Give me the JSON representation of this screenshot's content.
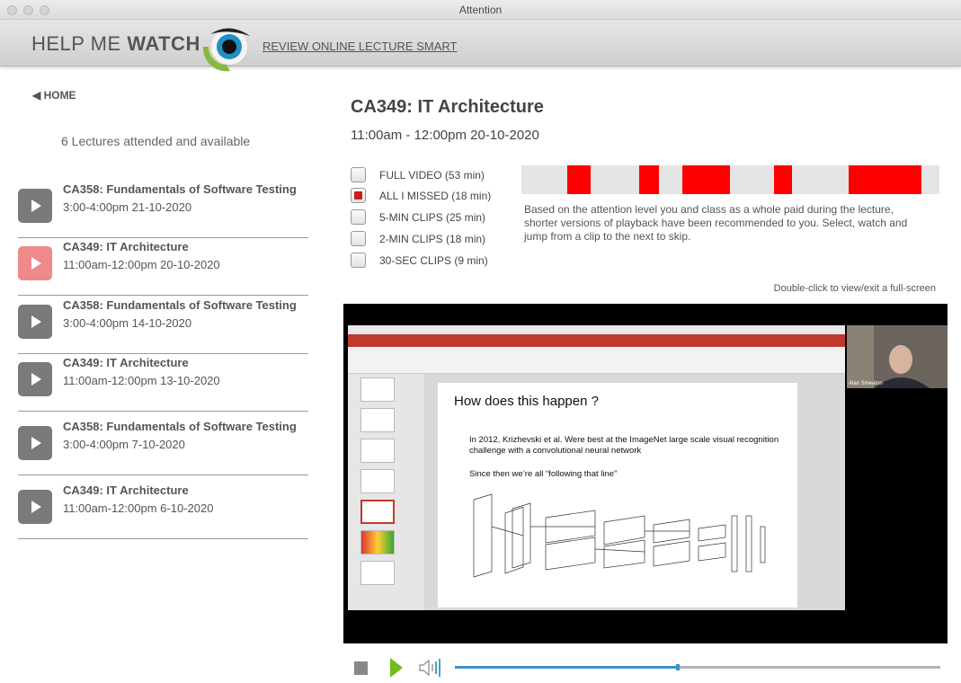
{
  "window": {
    "title": "Attention"
  },
  "header": {
    "brand_light": "HELP ME",
    "brand_bold": "WATCH",
    "tagline": "REVIEW ONLINE LECTURE SMART"
  },
  "sidebar": {
    "home_label": "◀ HOME",
    "summary": "6 Lectures attended and available",
    "lectures": [
      {
        "title": "CA358: Fundamentals of Software Testing",
        "time": "3:00-4:00pm 21-10-2020"
      },
      {
        "title": "CA349: IT Architecture",
        "time": "11:00am-12:00pm 20-10-2020"
      },
      {
        "title": "CA358: Fundamentals of Software Testing",
        "time": "3:00-4:00pm 14-10-2020"
      },
      {
        "title": "CA349: IT Architecture",
        "time": "11:00am-12:00pm 13-10-2020"
      },
      {
        "title": "CA358: Fundamentals of Software Testing",
        "time": "3:00-4:00pm 7-10-2020"
      },
      {
        "title": "CA349: IT Architecture",
        "time": "11:00am-12:00pm 6-10-2020"
      }
    ],
    "active_index": 1
  },
  "main": {
    "title": "CA349: IT Architecture",
    "time": "11:00am - 12:00pm 20-10-2020",
    "options": [
      {
        "label": "FULL VIDEO (53 min)",
        "checked": false
      },
      {
        "label": "ALL I MISSED (18 min)",
        "checked": true
      },
      {
        "label": "5-MIN CLIPS (25 min)",
        "checked": false
      },
      {
        "label": "2-MIN CLIPS (18 min)",
        "checked": false
      },
      {
        "label": "30-SEC CLIPS (9 min)",
        "checked": false
      }
    ],
    "description": "Based on the attention level you and class as a whole paid during the lecture, shorter versions of playback have been recommended to you. Select, watch and jump from a clip to the next to skip.",
    "fullscreen_hint": "Double-click to view/exit a full-screen",
    "missed_segments": [
      {
        "start": 0.11,
        "end": 0.165
      },
      {
        "start": 0.281,
        "end": 0.33
      },
      {
        "start": 0.385,
        "end": 0.5
      },
      {
        "start": 0.605,
        "end": 0.647
      },
      {
        "start": 0.783,
        "end": 0.958
      }
    ],
    "colors": {
      "missed": "#ff0000",
      "accent_play": "#6fbf1a",
      "progress": "#3a93c6"
    }
  },
  "video": {
    "slide_title": "How does this happen ?",
    "slide_bullet1": "In 2012, Krizhevski et al. Were best at the ImageNet large scale visual recognition challenge with a convolutional neural network",
    "slide_bullet2": "Since then we’re all “following that line”",
    "presenter_name": "Alan Smeaton",
    "progress": 0.46
  }
}
